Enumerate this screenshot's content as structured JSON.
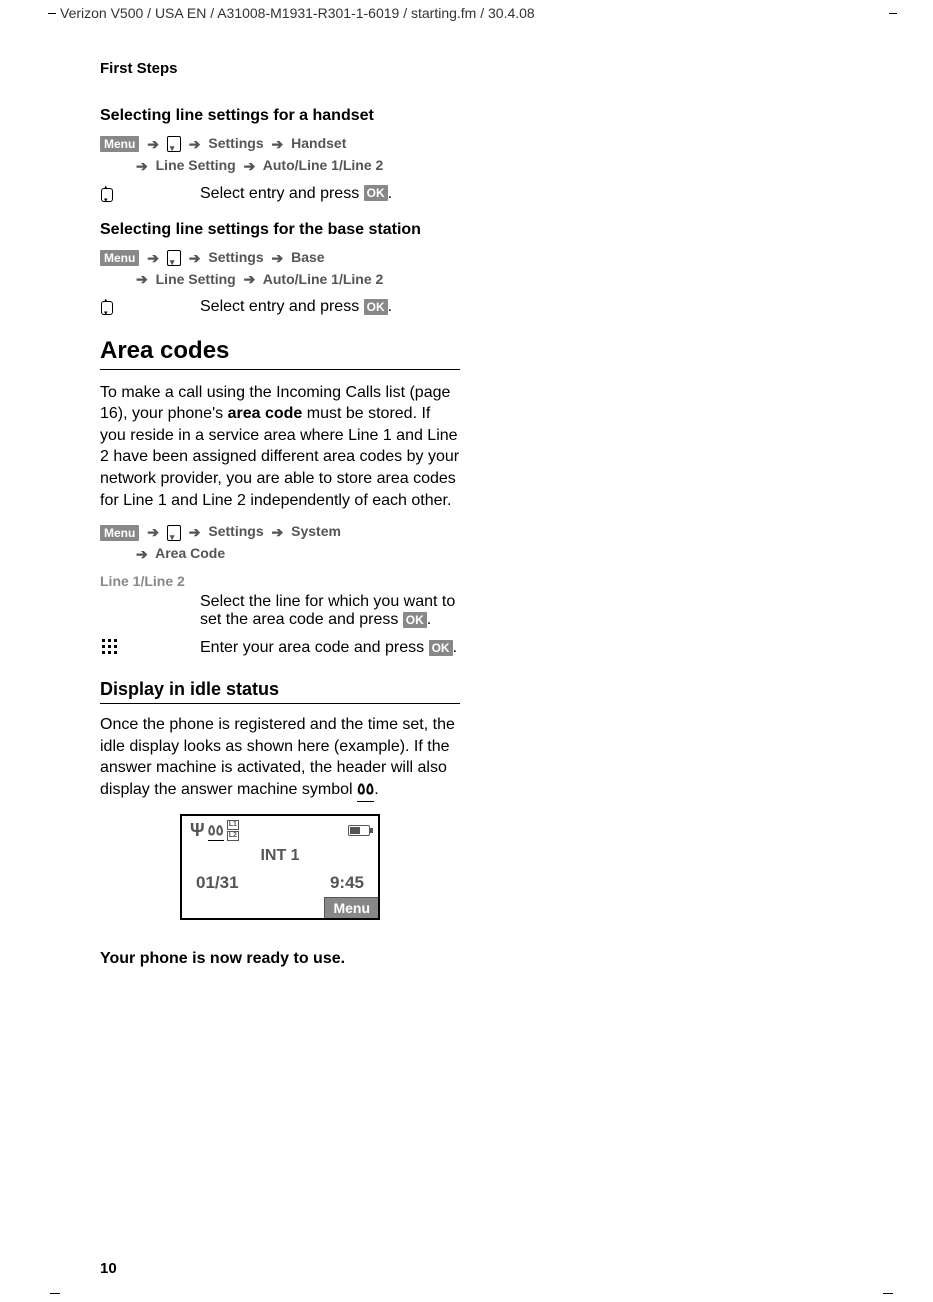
{
  "header": {
    "docPath": "Verizon V500 / USA EN / A31008-M1931-R301-1-6019 / starting.fm / 30.4.08"
  },
  "sectionLabel": "First Steps",
  "handsetSection": {
    "title": "Selecting line settings for a handset",
    "path1": {
      "menu": "Menu",
      "settings": "Settings",
      "target": "Handset"
    },
    "path2": {
      "lineSetting": "Line Setting",
      "options": "Auto/Line 1/Line 2"
    },
    "instruction": "Select entry and press ",
    "ok": "OK"
  },
  "baseSection": {
    "title": "Selecting line settings for the base station",
    "path1": {
      "menu": "Menu",
      "settings": "Settings",
      "target": "Base"
    },
    "path2": {
      "lineSetting": "Line Setting",
      "options": "Auto/Line 1/Line 2"
    },
    "instruction": "Select entry and press ",
    "ok": "OK"
  },
  "areaCodes": {
    "heading": "Area codes",
    "para1a": "To make a call using the Incoming Calls list (page 16), your phone's ",
    "para1bold": "area code",
    "para1b": " must be stored. If you reside in a service area where Line 1 and Line 2 have been assigned different area codes by your network provider, you are able to store area codes for Line 1 and Line 2 independently of each other.",
    "path1": {
      "menu": "Menu",
      "settings": "Settings",
      "target": "System"
    },
    "path2": {
      "areaCode": "Area Code"
    },
    "lineLabel": "Line 1/Line 2",
    "lineInstr": "Select the line for which you want to set the area code and press ",
    "ok1": "OK",
    "keypadInstr": "Enter your area code and press ",
    "ok2": "OK"
  },
  "idleStatus": {
    "heading": "Display in idle status",
    "para": "Once the phone is registered and the time set, the idle display looks as shown here (example). If the answer machine is activated, the header will also display the answer machine symbol ",
    "amSymbol": "٥٥",
    "display": {
      "l1": "L1",
      "l2": "L2",
      "int": "INT 1",
      "date": "01/31",
      "time": "9:45",
      "menuBtn": "Menu"
    }
  },
  "readyText": "Your phone is now ready to use.",
  "pageNumber": "10"
}
